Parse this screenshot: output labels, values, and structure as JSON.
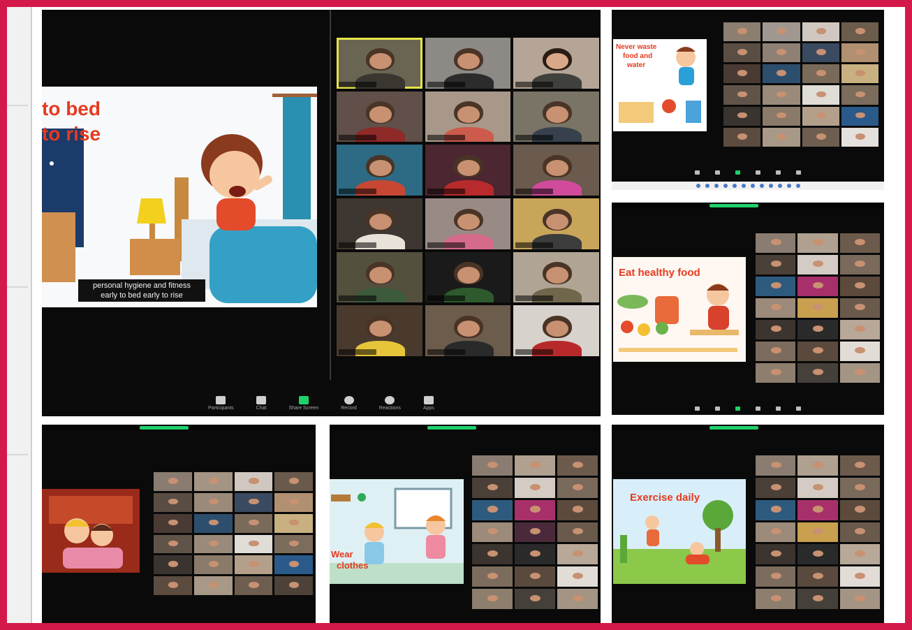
{
  "collage": {
    "border_color": "#d4184a",
    "background": "#ffffff"
  },
  "main_call": {
    "slide": {
      "title_line1": "to bed",
      "title_line2": "to rise",
      "caption_line1": "personal hygiene and fitness",
      "caption_line2": "early to bed early to rise",
      "title_color": "#e53a1f"
    },
    "toolbar": {
      "items": [
        {
          "label": "Participants",
          "icon": "participants-icon"
        },
        {
          "label": "Chat",
          "icon": "chat-icon"
        },
        {
          "label": "Share Screen",
          "icon": "share-screen-icon"
        },
        {
          "label": "Record",
          "icon": "record-icon"
        },
        {
          "label": "Reactions",
          "icon": "reactions-icon"
        },
        {
          "label": "Apps",
          "icon": "apps-icon"
        }
      ]
    }
  },
  "call_2": {
    "slide": {
      "title_line1": "Never waste",
      "title_line2": "food and",
      "title_line3": "water"
    }
  },
  "call_3": {
    "slide": {
      "title": "Eat healthy food"
    }
  },
  "call_5": {
    "slide": {
      "title_line1": "Wear",
      "title_line2": "clothes"
    }
  },
  "call_6": {
    "slide": {
      "title": "Exercise daily"
    }
  },
  "colors": {
    "zoom_green": "#1fd16a",
    "active_speaker": "#e5e34a",
    "window_bg": "#0a0a0a"
  }
}
